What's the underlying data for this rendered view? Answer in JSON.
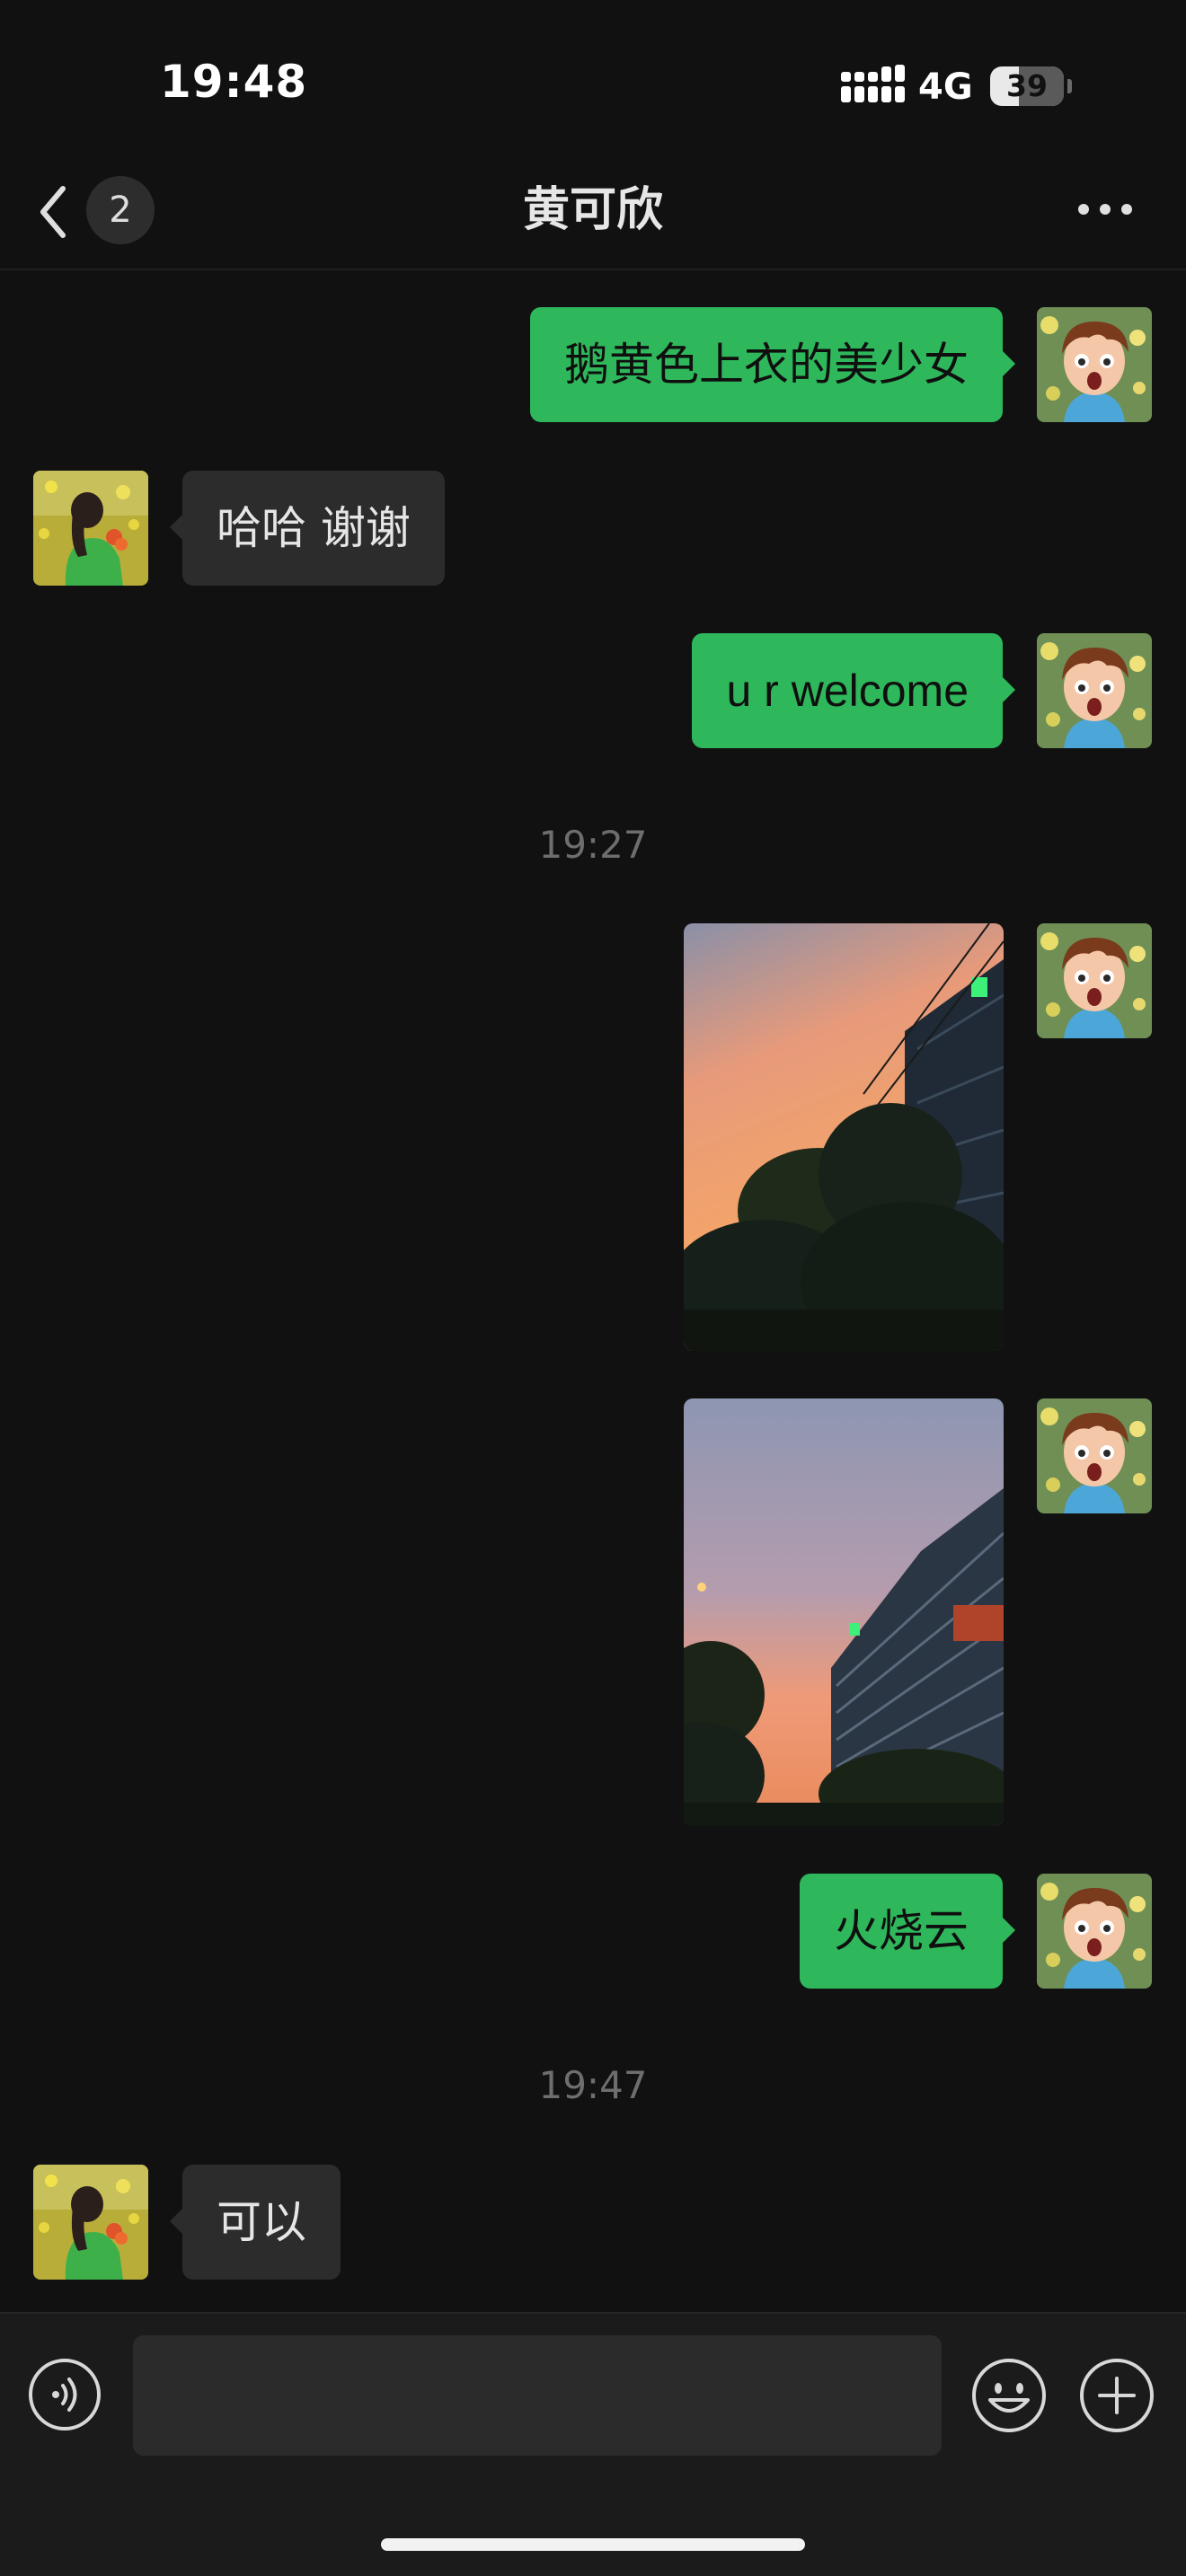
{
  "status_bar": {
    "time": "19:48",
    "network": "4G",
    "battery_level": "39",
    "battery_fraction": 0.39
  },
  "nav": {
    "back_icon": "chevron-left-icon",
    "unread_count": "2",
    "title": "黄可欣",
    "more_icon": "more-horizontal-icon"
  },
  "messages": [
    {
      "direction": "sent",
      "type": "text",
      "text": "鹅黄色上衣的美少女"
    },
    {
      "direction": "received",
      "type": "text",
      "text": "哈哈 谢谢"
    },
    {
      "direction": "sent",
      "type": "text",
      "text": "u r welcome"
    },
    {
      "type": "timestamp",
      "text": "19:27"
    },
    {
      "direction": "sent",
      "type": "image",
      "subject": "sunset sky with trees and office building"
    },
    {
      "direction": "sent",
      "type": "image",
      "subject": "sunset sky over glass office building"
    },
    {
      "direction": "sent",
      "type": "text",
      "text": "火烧云"
    },
    {
      "type": "timestamp",
      "text": "19:47"
    },
    {
      "direction": "received",
      "type": "text",
      "text": "可以"
    }
  ],
  "input_bar": {
    "voice_icon": "voice-icon",
    "input_value": "",
    "emoji_icon": "emoji-icon",
    "plus_icon": "plus-circle-icon"
  },
  "colors": {
    "background": "#111111",
    "sent_bubble": "#2fb85b",
    "received_bubble": "#2c2c2c",
    "timestamp": "#6e6e6e"
  }
}
